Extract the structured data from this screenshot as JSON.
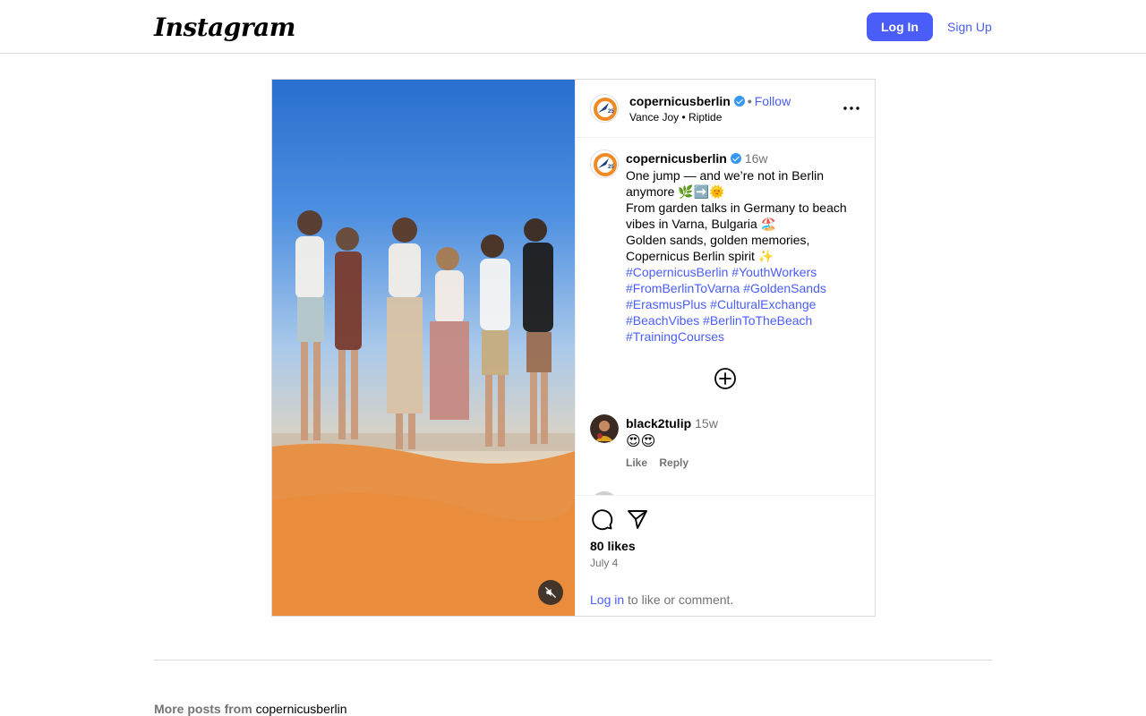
{
  "header": {
    "logo": "Instagram",
    "login_label": "Log In",
    "signup_label": "Sign Up"
  },
  "post": {
    "username": "copernicusberlin",
    "follow_label": "Follow",
    "music_artist": "Vance Joy",
    "music_track": "Riptide",
    "caption": {
      "username": "copernicusberlin",
      "time": "16w",
      "lines": [
        "One jump — and we’re not in Berlin anymore 🌿➡️🌞",
        "From garden talks in Germany to beach vibes in Varna, Bulgaria 🏖️",
        "Golden sands, golden memories, Copernicus Berlin spirit ✨"
      ],
      "hashtags": [
        "#CopernicusBerlin",
        "#YouthWorkers",
        "#FromBerlinToVarna",
        "#GoldenSands",
        "#ErasmusPlus",
        "#CulturalExchange",
        "#BeachVibes",
        "#BerlinToTheBeach",
        "#TrainingCourses"
      ]
    },
    "comments": [
      {
        "username": "black2tulip",
        "time": "15w",
        "text": "😍😍",
        "like_label": "Like",
        "reply_label": "Reply"
      }
    ],
    "likes": "80 likes",
    "date": "July 4",
    "login_prompt": {
      "link": "Log in",
      "rest": " to like or comment."
    }
  },
  "more_posts": {
    "prefix": "More posts from",
    "username": "copernicusberlin"
  },
  "colors": {
    "accent": "#4a5df9",
    "verified": "#3897f0",
    "border": "#dbdbdb",
    "muted_text": "#737373"
  }
}
